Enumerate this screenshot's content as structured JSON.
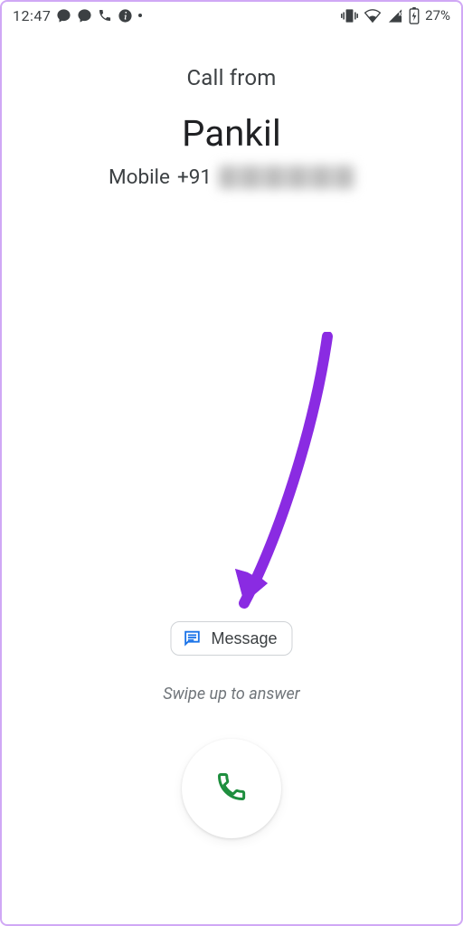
{
  "status": {
    "clock": "12:47",
    "battery_pct": "27%"
  },
  "call": {
    "from_label": "Call from",
    "caller_name": "Pankil",
    "line_label": "Mobile",
    "country_code": "+91"
  },
  "actions": {
    "message_label": "Message",
    "hint": "Swipe up to answer"
  },
  "colors": {
    "accent": "#8a2be2",
    "message_icon": "#1a73e8",
    "phone_icon": "#1e8e3e",
    "border": "#d0a8f5"
  },
  "icons": {
    "vibrate": "vibrate-icon",
    "wifi": "wifi-icon",
    "signal": "signal-icon",
    "battery": "battery-charging-icon",
    "chat1": "chat-bubble-icon",
    "chat2": "chat-bubble-icon",
    "phone_small": "phone-icon",
    "info": "info-icon",
    "dot": "dot-icon",
    "message": "message-icon",
    "phone_fab": "phone-icon"
  }
}
